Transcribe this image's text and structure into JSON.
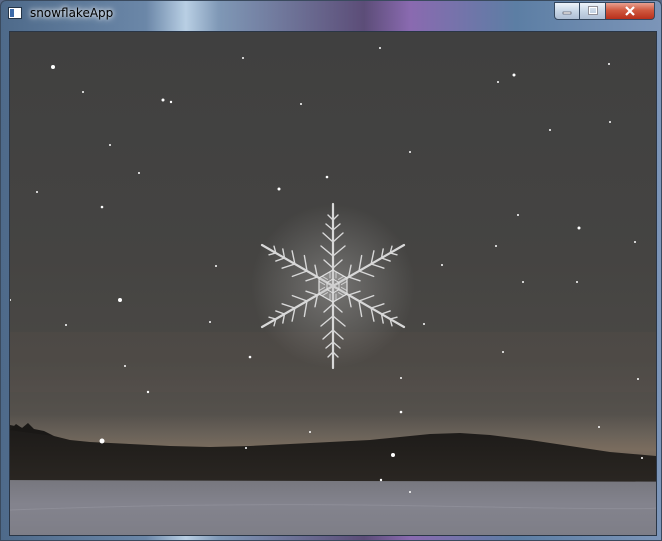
{
  "window": {
    "title": "snowflakeApp"
  },
  "controls": [
    {
      "name": "minimize-button",
      "icon": "minimize-icon"
    },
    {
      "name": "maximize-button",
      "icon": "maximize-icon"
    },
    {
      "name": "close-button",
      "icon": "close-icon"
    }
  ],
  "scene": {
    "description_icon": "snowflake-icon",
    "colors": {
      "sky": "#404040",
      "horizon": "#7a6c5e",
      "snow_ground": "#858590",
      "flake": "#dcdcdc"
    }
  }
}
